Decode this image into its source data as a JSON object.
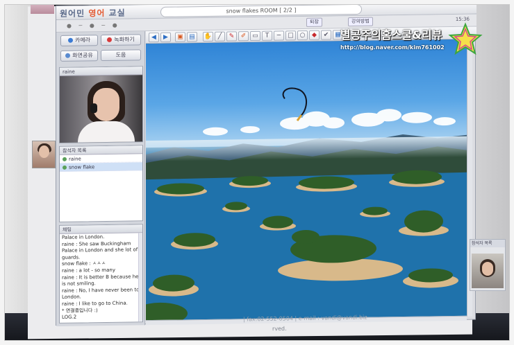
{
  "app": {
    "logo_main": "원어민 ",
    "logo_accent": "영어",
    "logo_tail": " 교실",
    "room_title": "snow flakes ROOM [ 2/2 ]",
    "top_right_btn1": "퇴장",
    "top_right_btn2": "강의방법",
    "clock": "15:36"
  },
  "left_panel": {
    "btn_camera": "카메라",
    "btn_record": "녹화하기",
    "btn_screen": "화면공유",
    "btn_small": "도움",
    "cam_user": "raine",
    "userlist_title": "참석자 목록",
    "users": [
      {
        "name": "raine",
        "selected": false
      },
      {
        "name": "snow flake",
        "selected": true
      }
    ],
    "chat_title": "채팅",
    "chat_lines": [
      "Palace in London.",
      "raine : She saw Buckingham",
      "Palace in London and she lot of",
      "guards.",
      "snow flake : ㅅㅅㅅ",
      "raine : a lot - so many",
      "raine : It is better B because he",
      "is not smiling.",
      "raine : No, I have never been to",
      "London.",
      "raine : I like to go to China.",
      "* 연결중입니다 :)",
      "LOG.2"
    ]
  },
  "right_panel": {
    "title": "참석자 목록"
  },
  "footer": {
    "line1": "| fax:02-552-0504 | e-mail : vandi@vandi.biz",
    "line2": "rved."
  },
  "watermark": {
    "title": "별공주의홈스쿨&리뷰",
    "url": "http://blog.naver.com/kim761002"
  },
  "colors": {
    "accent": "#e45b33",
    "selection": "#cfe0f6",
    "sky": "#2f84d6",
    "water": "#1f6ea8"
  }
}
